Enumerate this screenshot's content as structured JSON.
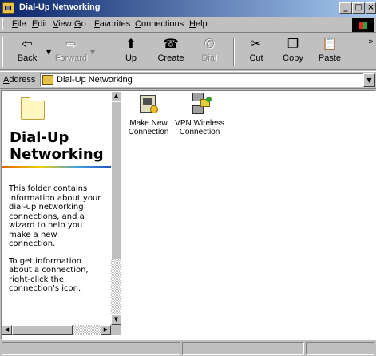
{
  "window": {
    "title": "Dial-Up Networking",
    "controls": {
      "minimize": "_",
      "maximize": "□",
      "close": "×"
    }
  },
  "menu": {
    "items": [
      "File",
      "Edit",
      "View",
      "Go",
      "Favorites",
      "Connections",
      "Help"
    ]
  },
  "toolbar": {
    "back": "Back",
    "forward": "Forward",
    "up": "Up",
    "create": "Create",
    "dial": "Dial",
    "cut": "Cut",
    "copy": "Copy",
    "paste": "Paste",
    "overflow": "»"
  },
  "address": {
    "label": "Address",
    "value": "Dial-Up Networking"
  },
  "left_panel": {
    "title": "Dial-Up\nNetworking",
    "paragraph1": "This folder contains information about your dial-up networking connections, and a wizard to help you make a new connection.",
    "paragraph2": "To get information about a connection, right-click the connection's icon."
  },
  "icons": [
    {
      "icon": "make-new-connection-icon",
      "label": "Make New Connection"
    },
    {
      "icon": "vpn-connection-icon",
      "label": "VPN Wireless Connection"
    }
  ],
  "status": {
    "pane1": "",
    "pane2": "",
    "pane3": ""
  }
}
